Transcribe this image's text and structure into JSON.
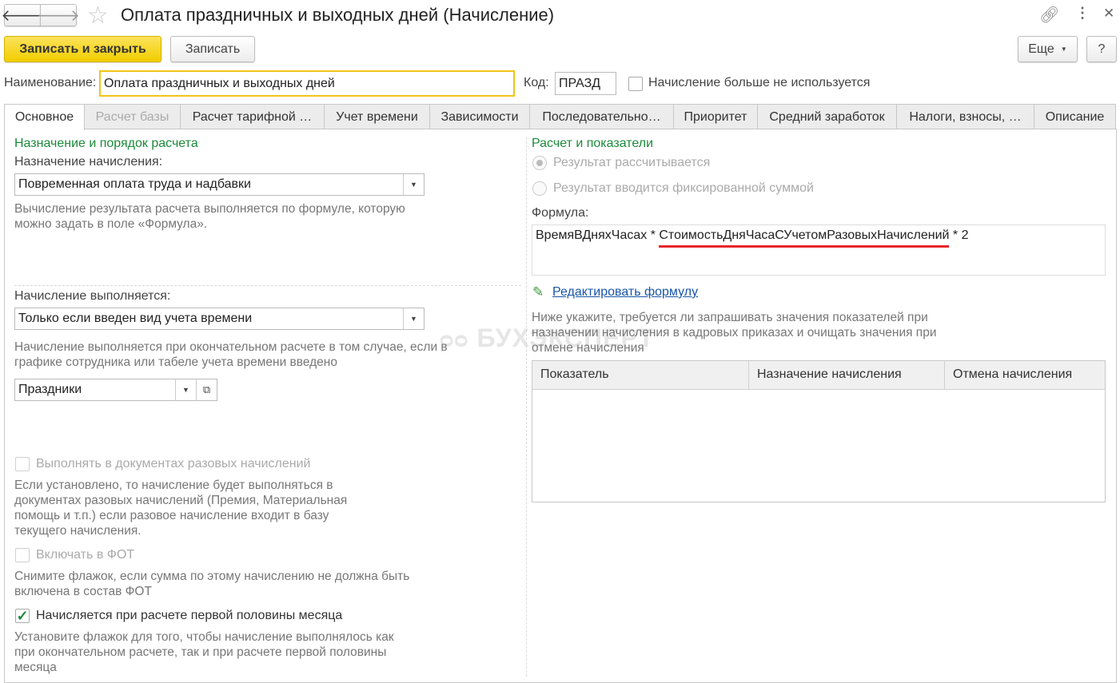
{
  "window": {
    "title": "Оплата праздничных и выходных дней (Начисление)"
  },
  "toolbar": {
    "save_close": "Записать и закрыть",
    "save": "Записать",
    "more": "Еще",
    "help": "?"
  },
  "header": {
    "name_label": "Наименование:",
    "name_value": "Оплата праздничных и выходных дней",
    "code_label": "Код:",
    "code_value": "ПРАЗД",
    "unused_label": "Начисление больше не используется"
  },
  "tabs": [
    "Основное",
    "Расчет базы",
    "Расчет тарифной …",
    "Учет времени",
    "Зависимости",
    "Последовательно…",
    "Приоритет",
    "Средний заработок",
    "Налоги, взносы, …",
    "Описание"
  ],
  "left": {
    "section_title": "Назначение и порядок расчета",
    "purpose_label": "Назначение начисления:",
    "purpose_value": "Повременная оплата труда и надбавки",
    "purpose_hint": "Вычисление результата расчета выполняется по формуле, которую можно задать в поле «Формула».",
    "exec_label": "Начисление выполняется:",
    "exec_value": "Только если введен вид учета времени",
    "exec_hint": "Начисление выполняется при окончательном расчете в том случае, если в графике сотрудника или табеле учета времени введено",
    "time_type_value": "Праздники",
    "onetime_label": "Выполнять в документах разовых начислений",
    "onetime_hint": "Если установлено, то начисление будет выполняться в документах разовых начислений (Премия, Материальная помощь и т.п.) если разовое начисление входит в базу текущего начисления.",
    "fot_label": "Включать в ФОТ",
    "fot_hint": "Снимите флажок, если сумма по этому начислению не должна быть включена в состав ФОТ",
    "half_label": "Начисляется при расчете первой половины месяца",
    "half_checked": true,
    "half_hint": "Установите флажок для того, чтобы начисление выполнялось как при окончательном расчете, так и при расчете первой половины месяца"
  },
  "right": {
    "section_title": "Расчет и показатели",
    "radio_calc": "Результат рассчитывается",
    "radio_fixed": "Результат вводится фиксированной суммой",
    "formula_label": "Формула:",
    "formula_part1": "ВремяВДняхЧасах * ",
    "formula_part2": "СтоимостьДняЧасаСУчетомРазовыхНачислений",
    "formula_part3": " * 2",
    "edit_formula": "Редактировать формулу",
    "indicators_hint": "Ниже укажите, требуется ли запрашивать значения показателей при назначении начисления в кадровых приказах и очищать значения при отмене начисления",
    "table_headers": [
      "Показатель",
      "Назначение начисления",
      "Отмена начисления"
    ]
  },
  "watermark": "БУХЭКСПЕРТ8",
  "colors": {
    "accent_yellow": "#f7d21a",
    "green": "#1b8a3a",
    "link": "#1a55a8",
    "underline_red": "#e8262a"
  }
}
